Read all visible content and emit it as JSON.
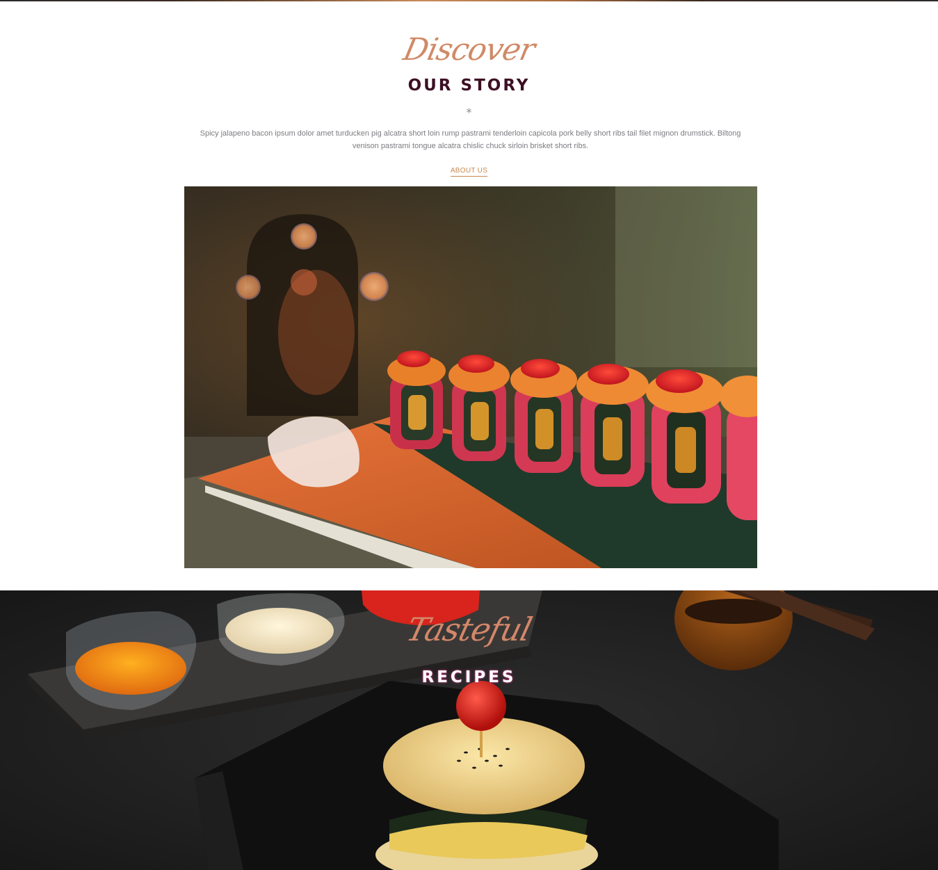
{
  "story": {
    "script_title": "Discover",
    "title": "OUR STORY",
    "divider": "*",
    "text": "Spicy jalapeno bacon ipsum dolor amet turducken pig alcatra short loin rump pastrami tenderloin capicola pork belly short ribs tail filet mignon drumstick. Biltong venison pastrami tongue alcatra chislic chuck sirloin brisket short ribs.",
    "link_label": "ABOUT US"
  },
  "recipes": {
    "script_title": "Tasteful",
    "title": "RECIPES"
  },
  "colors": {
    "script_accent": "#d08a66",
    "heading_dark": "#3d0f24",
    "link_gold": "#c9894f",
    "body_text": "#7c7c82"
  }
}
